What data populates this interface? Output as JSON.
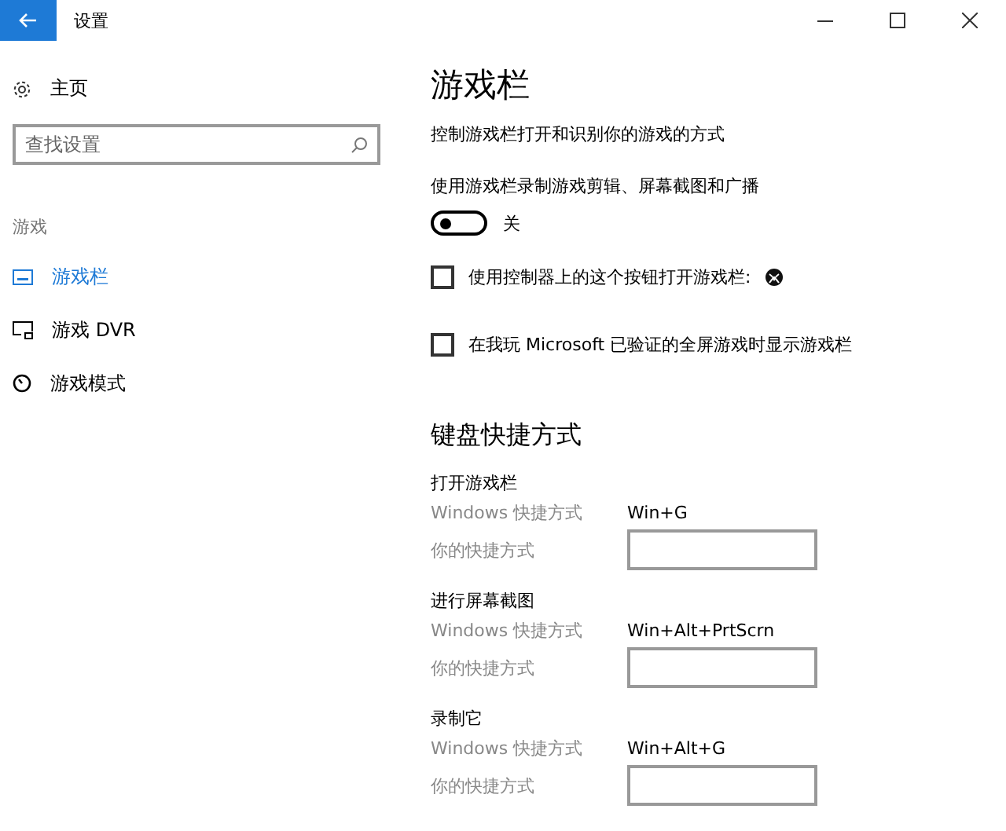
{
  "window": {
    "title": "设置"
  },
  "sidebar": {
    "home": "主页",
    "search": {
      "placeholder": "查找设置"
    },
    "section": "游戏",
    "items": [
      {
        "label": "游戏栏",
        "kind": "bar",
        "selected": true
      },
      {
        "label": "游戏 DVR",
        "kind": "dvr",
        "selected": false
      },
      {
        "label": "游戏模式",
        "kind": "mode",
        "selected": false
      }
    ]
  },
  "page": {
    "title": "游戏栏",
    "description": "控制游戏栏打开和识别你的游戏的方式",
    "toggle": {
      "label": "使用游戏栏录制游戏剪辑、屏幕截图和广播",
      "on": false,
      "state_text": "关"
    },
    "checkboxes": [
      {
        "label": "使用控制器上的这个按钮打开游戏栏:",
        "checked": false,
        "kind": "xbox"
      },
      {
        "label": "在我玩 Microsoft 已验证的全屏游戏时显示游戏栏",
        "checked": false,
        "kind": "plain"
      }
    ],
    "shortcuts_title": "键盘快捷方式",
    "shortcuts": [
      {
        "title": "打开游戏栏",
        "windows_label": "Windows 快捷方式",
        "windows_value": "Win+G",
        "custom_label": "你的快捷方式"
      },
      {
        "title": "进行屏幕截图",
        "windows_label": "Windows 快捷方式",
        "windows_value": "Win+Alt+PrtScrn",
        "custom_label": "你的快捷方式"
      },
      {
        "title": "录制它",
        "windows_label": "Windows 快捷方式",
        "windows_value": "Win+Alt+G",
        "custom_label": "你的快捷方式"
      }
    ]
  }
}
